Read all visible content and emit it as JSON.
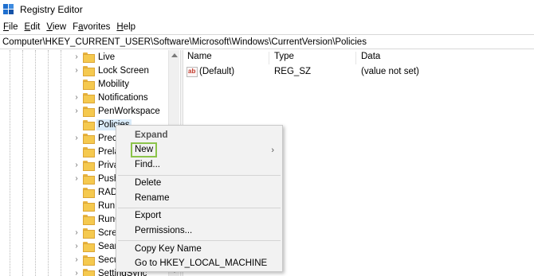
{
  "window": {
    "title": "Registry Editor"
  },
  "menu": [
    {
      "prefix": "",
      "key": "F",
      "rest": "ile"
    },
    {
      "prefix": "",
      "key": "E",
      "rest": "dit"
    },
    {
      "prefix": "",
      "key": "V",
      "rest": "iew"
    },
    {
      "prefix": "F",
      "key": "a",
      "rest": "vorites"
    },
    {
      "prefix": "",
      "key": "H",
      "rest": "elp"
    }
  ],
  "address": "Computer\\HKEY_CURRENT_USER\\Software\\Microsoft\\Windows\\CurrentVersion\\Policies",
  "tree": {
    "items": [
      {
        "label": "Live",
        "selected": false
      },
      {
        "label": "Lock Screen",
        "selected": false
      },
      {
        "label": "Mobility",
        "selected": false
      },
      {
        "label": "Notifications",
        "selected": false
      },
      {
        "label": "PenWorkspace",
        "selected": false
      },
      {
        "label": "Policies",
        "selected": true
      },
      {
        "label": "Precl",
        "selected": false
      },
      {
        "label": "Prela",
        "selected": false
      },
      {
        "label": "Priva",
        "selected": false
      },
      {
        "label": "Push",
        "selected": false
      },
      {
        "label": "RADA",
        "selected": false
      },
      {
        "label": "Run",
        "selected": false
      },
      {
        "label": "RunO",
        "selected": false
      },
      {
        "label": "Scree",
        "selected": false
      },
      {
        "label": "Sear",
        "selected": false
      },
      {
        "label": "Secu",
        "selected": false
      },
      {
        "label": "SettingSync",
        "selected": false
      }
    ]
  },
  "list": {
    "headers": {
      "name": "Name",
      "type": "Type",
      "data": "Data"
    },
    "rows": [
      {
        "icon": "string-value-icon",
        "icon_text": "ab",
        "name": "(Default)",
        "type": "REG_SZ",
        "data": "(value not set)"
      }
    ]
  },
  "context_menu": {
    "items": [
      {
        "id": "expand",
        "label": "Expand",
        "bold": true
      },
      {
        "id": "new",
        "label": "New",
        "submenu": true,
        "highlighted": true
      },
      {
        "id": "find",
        "label": "Find..."
      },
      {
        "id": "delete",
        "label": "Delete"
      },
      {
        "id": "rename",
        "label": "Rename"
      },
      {
        "id": "export",
        "label": "Export"
      },
      {
        "id": "permissions",
        "label": "Permissions..."
      },
      {
        "id": "copy-key-name",
        "label": "Copy Key Name"
      },
      {
        "id": "goto-hklm",
        "label": "Go to HKEY_LOCAL_MACHINE"
      }
    ],
    "submenu_arrow": "›"
  },
  "colors": {
    "selection": "#d9ebf9",
    "highlight_box": "#8bc34a",
    "menu_bg": "#f2f2f2"
  }
}
